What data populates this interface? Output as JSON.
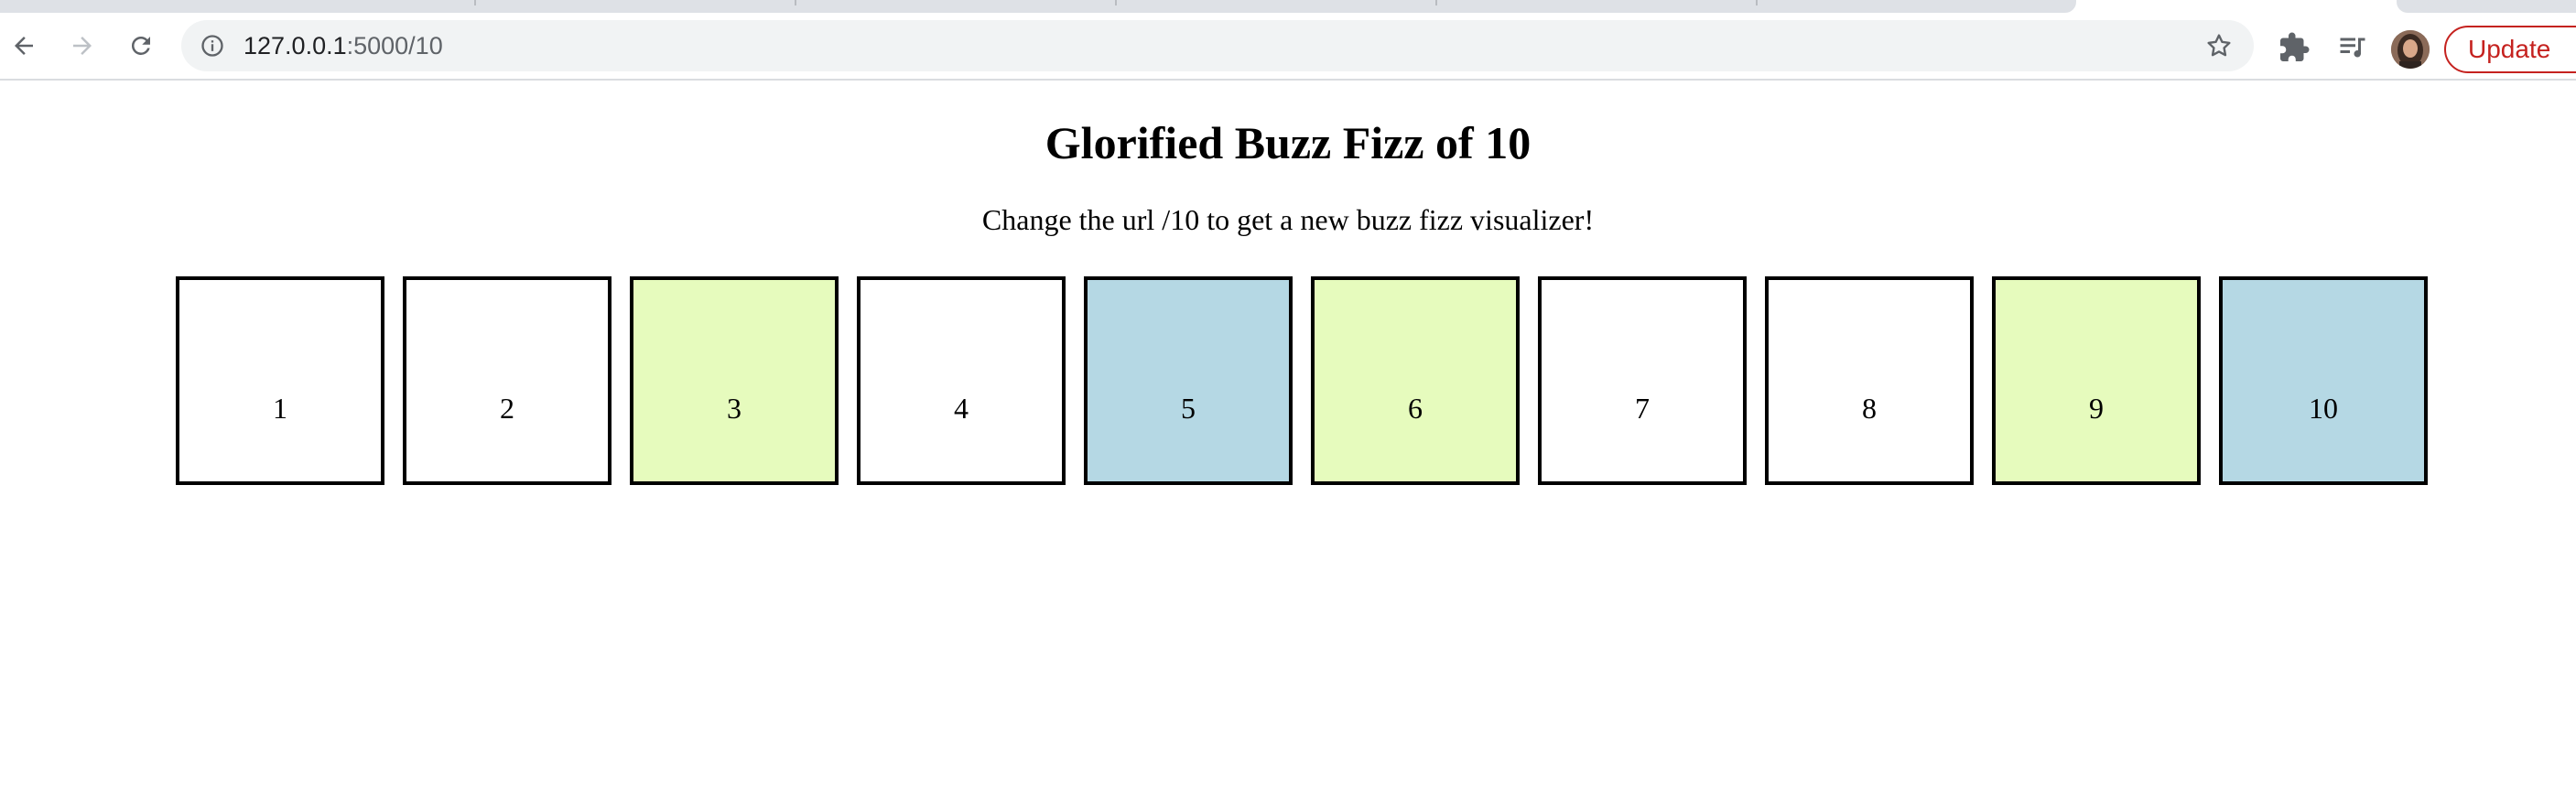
{
  "browser": {
    "url_host": "127.0.0.1",
    "url_path": ":5000/10",
    "update_label": "Update",
    "icons": {
      "back": "arrow-left-icon",
      "forward": "arrow-right-icon",
      "reload": "reload-icon",
      "site_info": "info-icon",
      "bookmark": "star-icon",
      "extensions": "puzzle-icon",
      "media": "playlist-icon",
      "profile": "avatar"
    }
  },
  "page": {
    "title": "Glorified Buzz Fizz of 10",
    "subtitle": "Change the url /10 to get a new buzz fizz visualizer!"
  },
  "colors": {
    "fizz": "#e6fbbd",
    "buzz": "#b5d8e4",
    "plain": "#ffffff",
    "update_accent": "#c5221f"
  },
  "cells": [
    {
      "label": "1",
      "kind": "plain"
    },
    {
      "label": "2",
      "kind": "plain"
    },
    {
      "label": "3",
      "kind": "fizz"
    },
    {
      "label": "4",
      "kind": "plain"
    },
    {
      "label": "5",
      "kind": "buzz"
    },
    {
      "label": "6",
      "kind": "fizz"
    },
    {
      "label": "7",
      "kind": "plain"
    },
    {
      "label": "8",
      "kind": "plain"
    },
    {
      "label": "9",
      "kind": "fizz"
    },
    {
      "label": "10",
      "kind": "buzz"
    }
  ]
}
